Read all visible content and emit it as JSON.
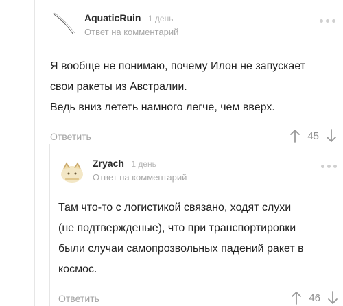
{
  "comments": [
    {
      "author": "AquaticRuin",
      "time": "1 день",
      "subtitle": "Ответ на комментарий",
      "lines": [
        "Я вообще не понимаю, почему Илон не запускает",
        "свои ракеты из Австралии.",
        "Ведь вниз лететь намного легче, чем вверх."
      ],
      "reply_label": "Ответить",
      "score": "45"
    },
    {
      "author": "Zryach",
      "time": "1 день",
      "subtitle": "Ответ на комментарий",
      "lines": [
        "Там что-то с логистикой связано, ходят слухи",
        "(не подтвержденые), что при транспортировки",
        "были случаи самопрозвольных падений ракет в",
        "космос."
      ],
      "reply_label": "Ответить",
      "score": "46"
    }
  ],
  "colors": {
    "author": "#2b2b2b",
    "muted": "#a8a8a8",
    "thread_line": "#e6e6e6"
  },
  "icons": [
    "options-dots-icon",
    "upvote-arrow-icon",
    "downvote-arrow-icon",
    "avatar-sketch-icon",
    "avatar-cat-icon"
  ]
}
